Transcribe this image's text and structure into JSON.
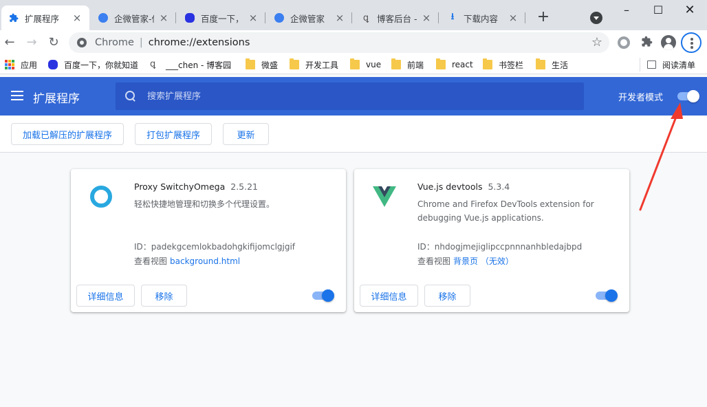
{
  "tabs": [
    {
      "title": "扩展程序",
      "active": true,
      "icon": "puzzle-icon"
    },
    {
      "title": "企微管家-仪",
      "active": false,
      "icon": "wecom-icon"
    },
    {
      "title": "百度一下，",
      "active": false,
      "icon": "baidu-icon"
    },
    {
      "title": "企微管家",
      "active": false,
      "icon": "wecom-icon"
    },
    {
      "title": "博客后台 - ",
      "active": false,
      "icon": "cnblogs-icon"
    },
    {
      "title": "下载内容",
      "active": false,
      "icon": "download-icon"
    }
  ],
  "omnibox": {
    "scheme_label": "Chrome",
    "separator": "|",
    "url": "chrome://extensions"
  },
  "bookmarks": {
    "items": [
      {
        "label": "应用",
        "icon": "apps-grid-icon"
      },
      {
        "label": "百度一下，你就知道",
        "icon": "baidu-icon"
      },
      {
        "label": "___chen - 博客园",
        "icon": "cnblogs-icon"
      },
      {
        "label": "微盛",
        "icon": "folder-icon"
      },
      {
        "label": "开发工具",
        "icon": "folder-icon"
      },
      {
        "label": "vue",
        "icon": "folder-icon"
      },
      {
        "label": "前端",
        "icon": "folder-icon"
      },
      {
        "label": "react",
        "icon": "folder-icon"
      },
      {
        "label": "书签栏",
        "icon": "folder-icon"
      },
      {
        "label": "生活",
        "icon": "folder-icon"
      }
    ],
    "reading_list": "阅读清单"
  },
  "header": {
    "title": "扩展程序",
    "search_placeholder": "搜索扩展程序",
    "dev_mode_label": "开发者模式",
    "dev_mode_on": true
  },
  "actions": {
    "load_unpacked": "加载已解压的扩展程序",
    "pack": "打包扩展程序",
    "update": "更新"
  },
  "extensions": [
    {
      "name": "Proxy SwitchyOmega",
      "version": "2.5.21",
      "description": "轻松快捷地管理和切换多个代理设置。",
      "id_label": "ID：",
      "id": "padekgcemlokbadohgkifijomclgjgif",
      "views_label": "查看视图",
      "view_link": "background.html",
      "details_label": "详细信息",
      "remove_label": "移除",
      "enabled": true
    },
    {
      "name": "Vue.js devtools",
      "version": "5.3.4",
      "description": "Chrome and Firefox DevTools extension for debugging Vue.js applications.",
      "id_label": "ID：",
      "id": "nhdogjmejiglipccpnnnanhbledajbpd",
      "views_label": "查看视图",
      "view_link": "背景页 （无效）",
      "details_label": "详细信息",
      "remove_label": "移除",
      "enabled": true
    }
  ],
  "colors": {
    "header_bg": "#3367d6",
    "accent": "#1a73e8",
    "tabstrip_bg": "#dee1e6",
    "annotation": "#f03a2e"
  }
}
